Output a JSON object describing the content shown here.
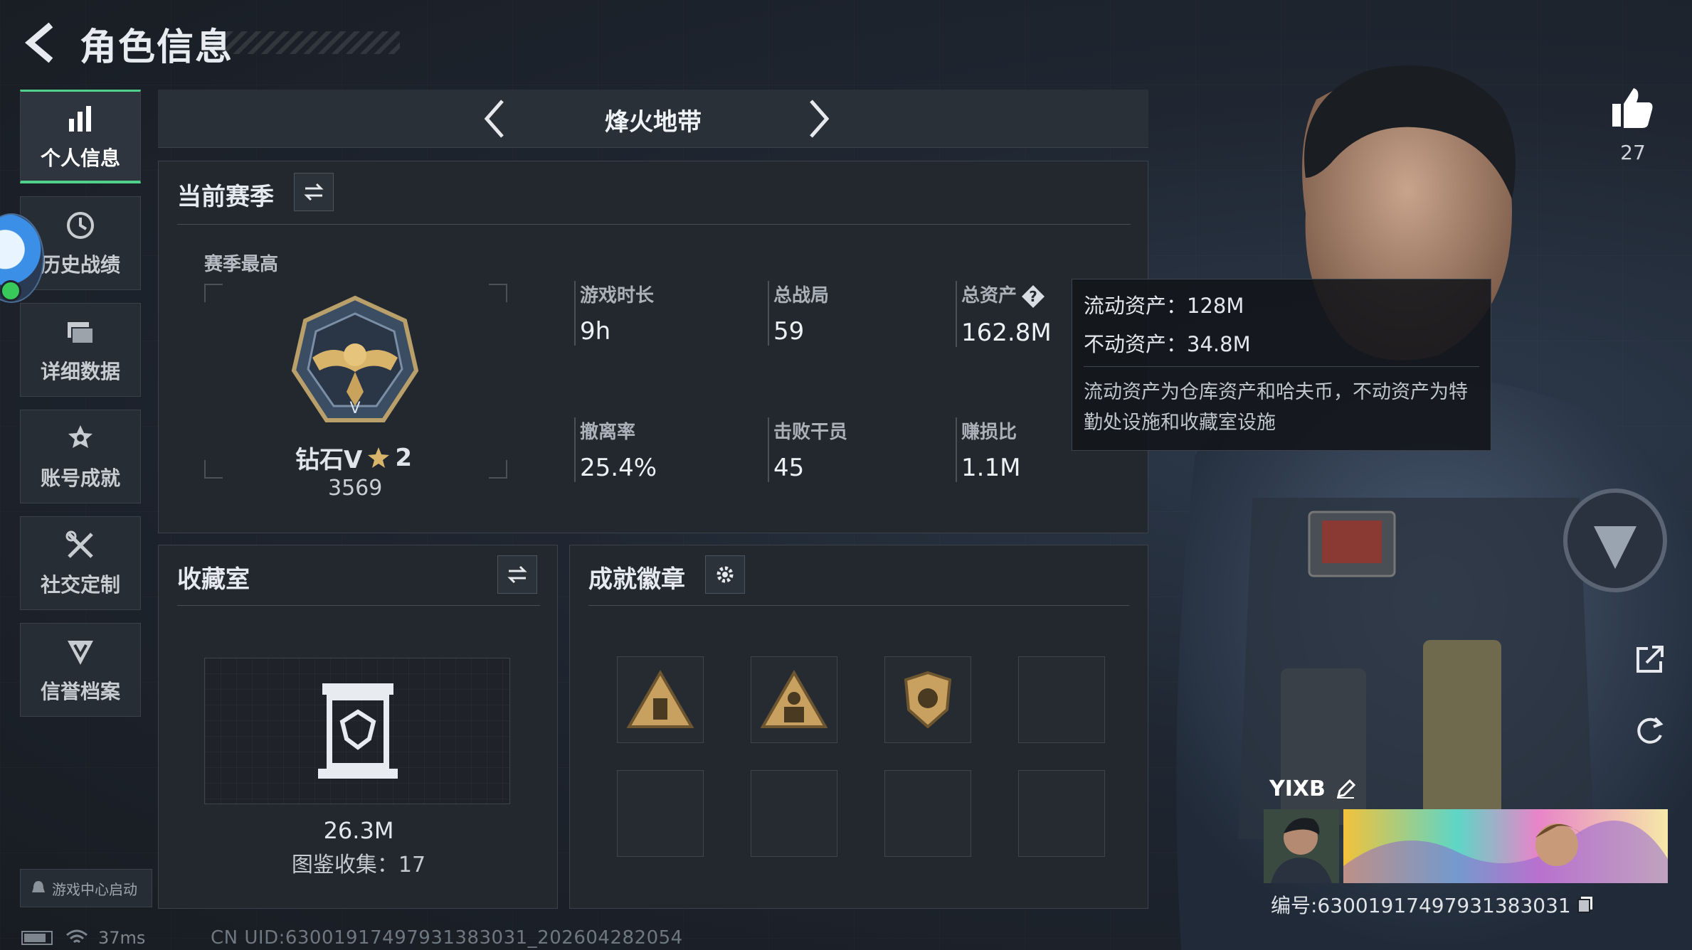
{
  "header": {
    "title": "角色信息"
  },
  "sidebar": {
    "items": [
      {
        "label": "个人信息",
        "icon": "bar-chart-icon",
        "active": true
      },
      {
        "label": "历史战绩",
        "icon": "history-clock-icon",
        "active": false
      },
      {
        "label": "详细数据",
        "icon": "data-cards-icon",
        "active": false
      },
      {
        "label": "账号成就",
        "icon": "achievement-star-icon",
        "active": false
      },
      {
        "label": "社交定制",
        "icon": "tools-cross-icon",
        "active": false
      },
      {
        "label": "信誉档案",
        "icon": "shield-badge-icon",
        "active": false
      }
    ],
    "game_center": "游戏中心启动"
  },
  "status": {
    "ping": "37ms",
    "uid": "CN UID:630019174979313830​31_202604282054"
  },
  "mode": {
    "name": "烽火地带"
  },
  "season": {
    "title": "当前赛季",
    "best_label": "赛季最高",
    "rank_name": "钻石V",
    "rank_stars": "2",
    "rank_score": "3569",
    "stats": {
      "play_time": {
        "label": "游戏时长",
        "value": "9h"
      },
      "matches": {
        "label": "总战局",
        "value": "59"
      },
      "assets": {
        "label": "总资产",
        "value": "162.8M"
      },
      "extract_rate": {
        "label": "撤离率",
        "value": "25.4%"
      },
      "kills": {
        "label": "击败干员",
        "value": "45"
      },
      "profit_ratio": {
        "label": "赚损比",
        "value": "1.1M"
      }
    }
  },
  "tooltip": {
    "liquid": "流动资产：128M",
    "fixed": "不动资产：34.8M",
    "desc": "流动资产为仓库资产和哈夫币，不动资产为特勤处设施和收藏室设施"
  },
  "collection": {
    "title": "收藏室",
    "value": "26.3M",
    "count": "图鉴收集：17"
  },
  "badges": {
    "title": "成就徽章"
  },
  "player": {
    "likes": "27",
    "name": "YIXB",
    "id": "编号:630019174979313830​31"
  },
  "colors": {
    "accent": "#4fd18b",
    "panel": "#23282f",
    "background": "#1c2128"
  }
}
